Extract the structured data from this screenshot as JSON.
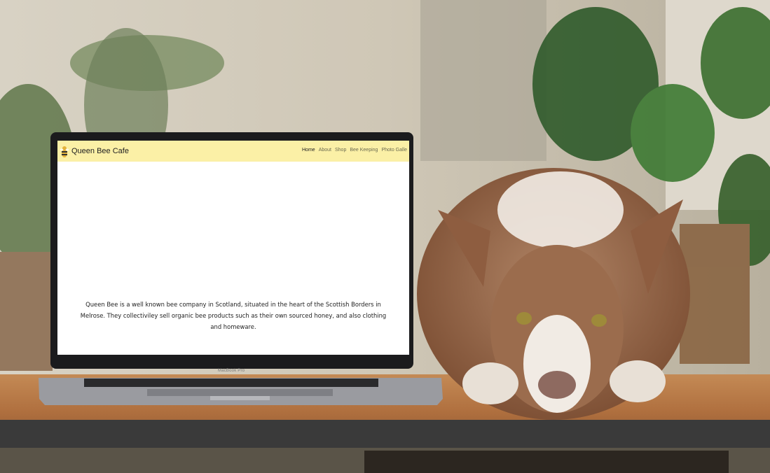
{
  "site": {
    "brand_name": "Queen Bee Cafe",
    "nav": [
      {
        "label": "Home",
        "active": true
      },
      {
        "label": "About",
        "active": false
      },
      {
        "label": "Shop",
        "active": false
      },
      {
        "label": "Bee Keeping",
        "active": false
      },
      {
        "label": "Photo Galle",
        "active": false
      }
    ],
    "carousel": {
      "prev_icon": "chevron-left-icon",
      "next_icon": "chevron-right-icon"
    },
    "intro_lines": [
      "Queen Bee is a well known bee company in Scotland, situated in the heart of the Scottish Borders in",
      "Melrose. They collectiviley sell organic bee products such as their own sourced honey, and also clothing",
      "and homeware."
    ]
  },
  "laptop": {
    "model_label": "MacBook Pro"
  },
  "colors": {
    "header_bg": "#fbf0a6",
    "table_wood": "#b0703f",
    "dog_fur": "#8a5a3c"
  }
}
